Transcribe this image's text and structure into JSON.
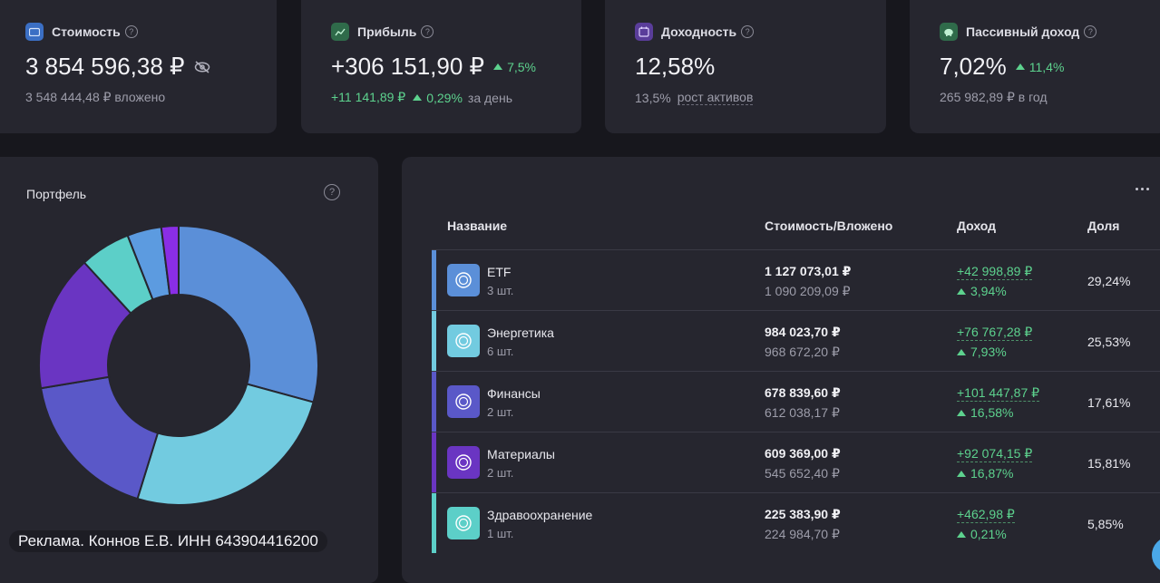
{
  "stats": [
    {
      "title": "Стоимость",
      "value": "3 854 596,38 ₽",
      "sub": "3 548 444,48 ₽ вложено",
      "icon": "wallet-icon",
      "icon_color": "#3b6fc4"
    },
    {
      "title": "Прибыль",
      "value": "+306 151,90 ₽",
      "value_change": "7,5%",
      "sub_amount": "+11 141,89 ₽",
      "sub_pct": "0,29%",
      "sub_suffix": "за день",
      "icon": "chart-line-icon",
      "icon_color": "#2f6b4a"
    },
    {
      "title": "Доходность",
      "value": "12,58%",
      "sub_pct": "13,5%",
      "sub_link": "рост активов",
      "icon": "calendar-icon",
      "icon_color": "#5a3d9a"
    },
    {
      "title": "Пассивный доход",
      "value": "7,02%",
      "value_change": "11,4%",
      "sub": "265 982,89 ₽ в год",
      "icon": "piggy-bank-icon",
      "icon_color": "#2f6b4a"
    }
  ],
  "portfolio": {
    "title": "Портфель",
    "slices": [
      {
        "label": "ETF",
        "share": 29.24,
        "color": "#5b8fd8"
      },
      {
        "label": "Энергетика",
        "share": 25.53,
        "color": "#72cbe0"
      },
      {
        "label": "Финансы",
        "share": 17.61,
        "color": "#5a58c8"
      },
      {
        "label": "Материалы",
        "share": 15.81,
        "color": "#6a35c2"
      },
      {
        "label": "Здравоохранение",
        "share": 5.85,
        "color": "#5ccfc8"
      },
      {
        "label": "",
        "share": 3.96,
        "color": "#5c9be0"
      },
      {
        "label": "",
        "share": 2.0,
        "color": "#8a2ee6"
      }
    ]
  },
  "table": {
    "headers": {
      "name": "Название",
      "value": "Стоимость/Вложено",
      "income": "Доход",
      "share": "Доля"
    },
    "rows": [
      {
        "name": "ETF",
        "qty": "3 шт.",
        "value": "1 127 073,01 ₽",
        "invested": "1 090 209,09 ₽",
        "income": "+42 998,89 ₽",
        "income_pct": "3,94%",
        "share": "29,24%",
        "color": "#5b8fd8"
      },
      {
        "name": "Энергетика",
        "qty": "6 шт.",
        "value": "984 023,70 ₽",
        "invested": "968 672,20 ₽",
        "income": "+76 767,28 ₽",
        "income_pct": "7,93%",
        "share": "25,53%",
        "color": "#72cbe0"
      },
      {
        "name": "Финансы",
        "qty": "2 шт.",
        "value": "678 839,60 ₽",
        "invested": "612 038,17 ₽",
        "income": "+101 447,87 ₽",
        "income_pct": "16,58%",
        "share": "17,61%",
        "color": "#5a58c8"
      },
      {
        "name": "Материалы",
        "qty": "2 шт.",
        "value": "609 369,00 ₽",
        "invested": "545 652,40 ₽",
        "income": "+92 074,15 ₽",
        "income_pct": "16,87%",
        "share": "15,81%",
        "color": "#6a35c2"
      },
      {
        "name": "Здравоохранение",
        "qty": "1 шт.",
        "value": "225 383,90 ₽",
        "invested": "224 984,70 ₽",
        "income": "+462,98 ₽",
        "income_pct": "0,21%",
        "share": "5,85%",
        "color": "#5ccfc8"
      }
    ]
  },
  "ad": {
    "text": "Реклама. Коннов Е.В. ИНН 643904416200"
  }
}
